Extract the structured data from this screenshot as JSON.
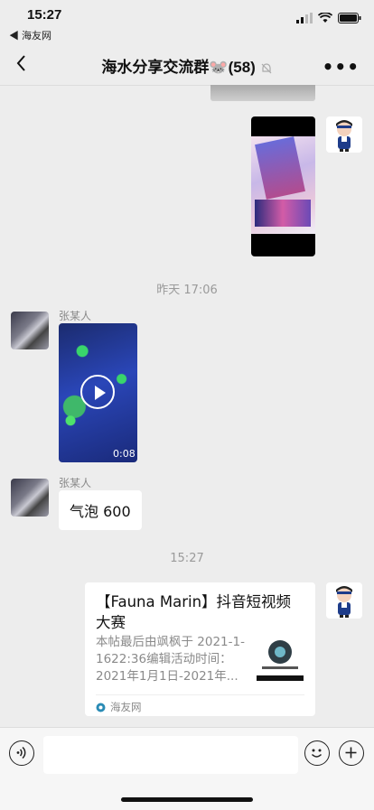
{
  "status": {
    "time": "15:27",
    "back_app": "◀ 海友网"
  },
  "header": {
    "title": "海水分享交流群🐭(58)",
    "more": "•••"
  },
  "messages": {
    "time_1": "昨天 17:06",
    "sender_1": "张某人",
    "video_duration": "0:08",
    "sender_2": "张某人",
    "text_2": "气泡 600",
    "time_2": "15:27",
    "card": {
      "title": "【Fauna Marin】抖音短视频大赛",
      "desc": "本帖最后由飒枫于 2021-1-1622:36编辑活动时间：2021年1月1日-2021年...",
      "source": "海友网"
    }
  },
  "input": {
    "placeholder": ""
  },
  "colors": {
    "background": "#ededed",
    "bubble": "#ffffff"
  }
}
